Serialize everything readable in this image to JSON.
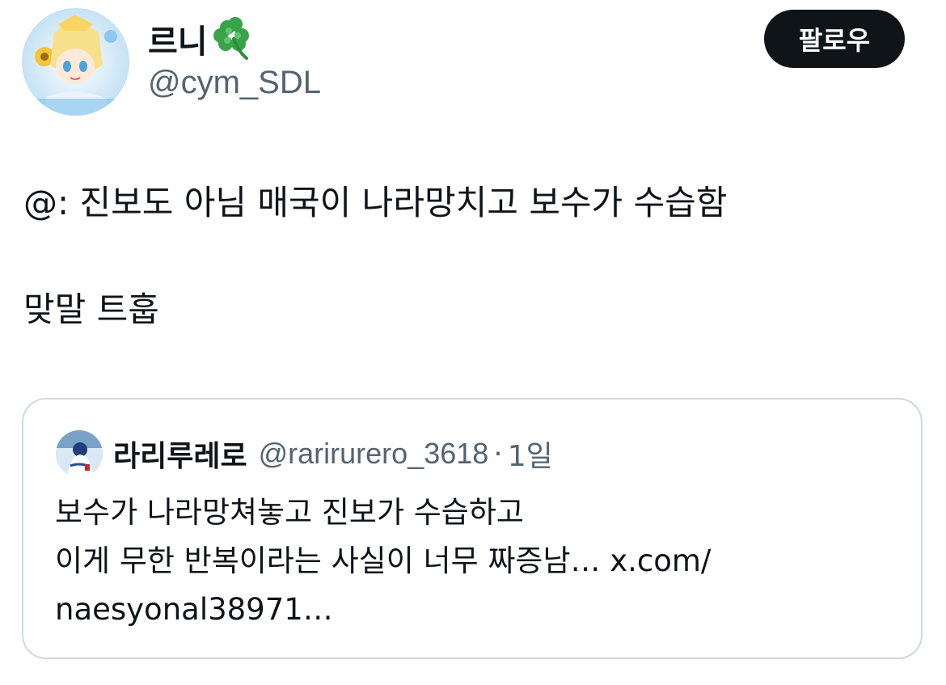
{
  "author": {
    "display_name": "르니",
    "handle": "@cym_SDL",
    "emoji_icon": "four-leaf-clover-icon"
  },
  "follow_button": {
    "label": "팔로우"
  },
  "tweet": {
    "lines": [
      "@: 진보도 아님 매국이 나라망치고 보수가 수습함",
      "맞말 트훕"
    ]
  },
  "quoted_tweet": {
    "display_name": "라리루레로",
    "handle": "@rarirurero_3618",
    "separator": "·",
    "time": "1일",
    "lines": [
      "보수가 나라망쳐놓고 진보가 수습하고",
      "이게 무한 반복이라는 사실이 너무 짜증남… x.com/",
      "naesyonal38971…"
    ]
  },
  "colors": {
    "text_primary": "#0f1419",
    "text_secondary": "#536471",
    "border": "#cfd9de",
    "follow_bg": "#0f1419",
    "clover_green": "#3aa34a"
  }
}
